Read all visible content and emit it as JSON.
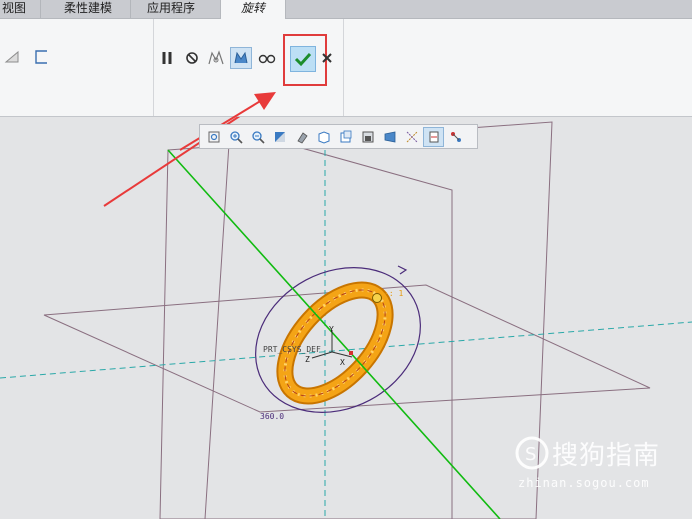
{
  "tabs": [
    {
      "label": "视图"
    },
    {
      "label": "柔性建模"
    },
    {
      "label": "应用程序"
    },
    {
      "label": "旋转"
    }
  ],
  "ribbon": {
    "buttons": [
      {
        "icon": "sketch-icon"
      },
      {
        "icon": "rectangle-icon"
      },
      {
        "icon": "pause-icon"
      },
      {
        "icon": "no-preview-icon"
      },
      {
        "icon": "geometry-preview-icon"
      },
      {
        "icon": "verify-mode-icon"
      },
      {
        "icon": "glasses-preview-icon"
      },
      {
        "icon": "ok-check-icon"
      },
      {
        "icon": "cancel-x-icon"
      }
    ]
  },
  "view_toolbar": {
    "icons": [
      "refit-icon",
      "zoom-in-icon",
      "zoom-out-icon",
      "repaint-icon",
      "shading-icon",
      "display-style-icon",
      "saved-orientations-icon",
      "view-manager-icon",
      "perspective-icon",
      "datum-display-icon",
      "spin-center-icon",
      "annotation-display-icon"
    ]
  },
  "viewport": {
    "csys_label": "PRT_CSYS_DEF",
    "angle_label": "360.0",
    "axis_y": "Y",
    "axis_z": "Z",
    "axis_x": "X",
    "colors": {
      "torus": "#f4a416",
      "axis_line": "#11bb11",
      "datum_plane": "#8a6f80",
      "arrow": "#e83a3a"
    }
  },
  "watermark": {
    "main": "搜狗指南",
    "sub": "zhinan.sogou.com"
  }
}
